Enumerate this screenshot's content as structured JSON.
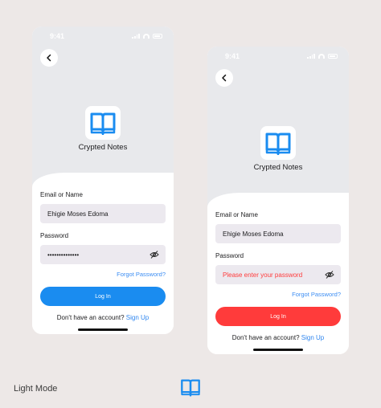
{
  "colors": {
    "background": "#ede8e7",
    "primary_blue": "#1a8cf0",
    "error_red": "#ff3b3b",
    "field_bg": "#ece9ef",
    "link_blue": "#3d8ef3"
  },
  "screens": [
    {
      "status_time": "9:41",
      "app_name": "Crypted Notes",
      "email_label": "Email or Name",
      "email_value": "Ehigie Moses Edoma",
      "password_label": "Password",
      "password_value": "••••••••••••••",
      "forgot_label": "Forgot Password?",
      "login_label": "Log In",
      "signup_prompt": "Don't have an account?",
      "signup_link": "Sign Up"
    },
    {
      "status_time": "9:41",
      "app_name": "Crypted Notes",
      "email_label": "Email or Name",
      "email_value": "Ehigie Moses Edoma",
      "password_label": "Password",
      "password_value": "Please enter your password",
      "forgot_label": "Forgot Password?",
      "login_label": "Log In",
      "signup_prompt": "Don't have an account?",
      "signup_link": "Sign Up"
    }
  ],
  "footer": {
    "mode_label": "Light Mode",
    "logo_icon": "open-book-icon"
  }
}
